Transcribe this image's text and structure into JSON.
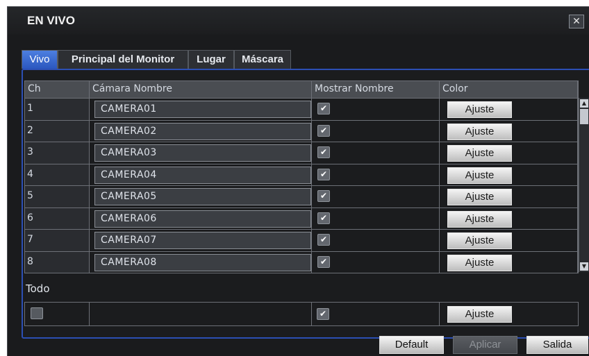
{
  "window": {
    "title": "EN VIVO",
    "close_label": "✕"
  },
  "tabs": [
    {
      "label": "Vivo",
      "active": true
    },
    {
      "label": "Principal del Monitor",
      "active": false
    },
    {
      "label": "Lugar",
      "active": false
    },
    {
      "label": "Máscara",
      "active": false
    }
  ],
  "table": {
    "columns": {
      "ch": "Ch",
      "name": "Cámara Nombre",
      "show": "Mostrar Nombre",
      "color": "Color"
    },
    "button_label": "Ajuste",
    "checkmark": "✔",
    "rows": [
      {
        "ch": "1",
        "name": "CAMERA01",
        "show": true
      },
      {
        "ch": "2",
        "name": "CAMERA02",
        "show": true
      },
      {
        "ch": "3",
        "name": "CAMERA03",
        "show": true
      },
      {
        "ch": "4",
        "name": "CAMERA04",
        "show": true
      },
      {
        "ch": "5",
        "name": "CAMERA05",
        "show": true
      },
      {
        "ch": "6",
        "name": "CAMERA06",
        "show": true
      },
      {
        "ch": "7",
        "name": "CAMERA07",
        "show": true
      },
      {
        "ch": "8",
        "name": "CAMERA08",
        "show": true
      }
    ]
  },
  "all": {
    "label": "Todo",
    "select_all": false,
    "show": true,
    "button_label": "Ajuste"
  },
  "footer": {
    "default_label": "Default",
    "apply_label": "Aplicar",
    "exit_label": "Salida"
  },
  "colors": {
    "accent": "#2c4fb4",
    "active_tab": "#3f6fd6",
    "window_bg": "#1a1b1d"
  }
}
